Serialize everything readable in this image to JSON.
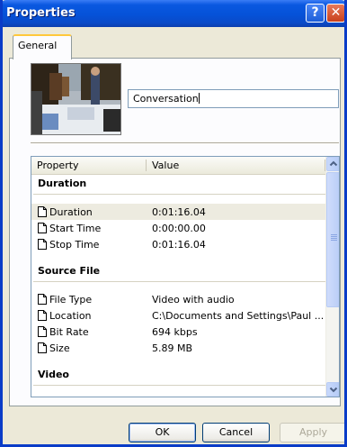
{
  "window": {
    "title": "Properties"
  },
  "titlebar": {
    "help_glyph": "?",
    "close_glyph": "✕"
  },
  "tabs": [
    {
      "label": "General"
    }
  ],
  "general": {
    "name_value": "Conversation"
  },
  "list": {
    "header": {
      "property": "Property",
      "value": "Value"
    },
    "groups": {
      "duration": {
        "label": "Duration",
        "rows": [
          {
            "label": "Duration",
            "value": "0:01:16.04"
          },
          {
            "label": "Start Time",
            "value": "0:00:00.00"
          },
          {
            "label": "Stop Time",
            "value": "0:01:16.04"
          }
        ]
      },
      "source_file": {
        "label": "Source File",
        "rows": [
          {
            "label": "File Type",
            "value": "Video with audio"
          },
          {
            "label": "Location",
            "value": "C:\\Documents and Settings\\Paul ..."
          },
          {
            "label": "Bit Rate",
            "value": "694 kbps"
          },
          {
            "label": "Size",
            "value": "5.89 MB"
          }
        ]
      },
      "video": {
        "label": "Video"
      }
    }
  },
  "buttons": {
    "ok": "OK",
    "cancel": "Cancel",
    "apply": "Apply"
  },
  "colors": {
    "titlebar": "#0552d8",
    "dialog_bg": "#ece9d8",
    "selected_row": "#edebe0"
  }
}
